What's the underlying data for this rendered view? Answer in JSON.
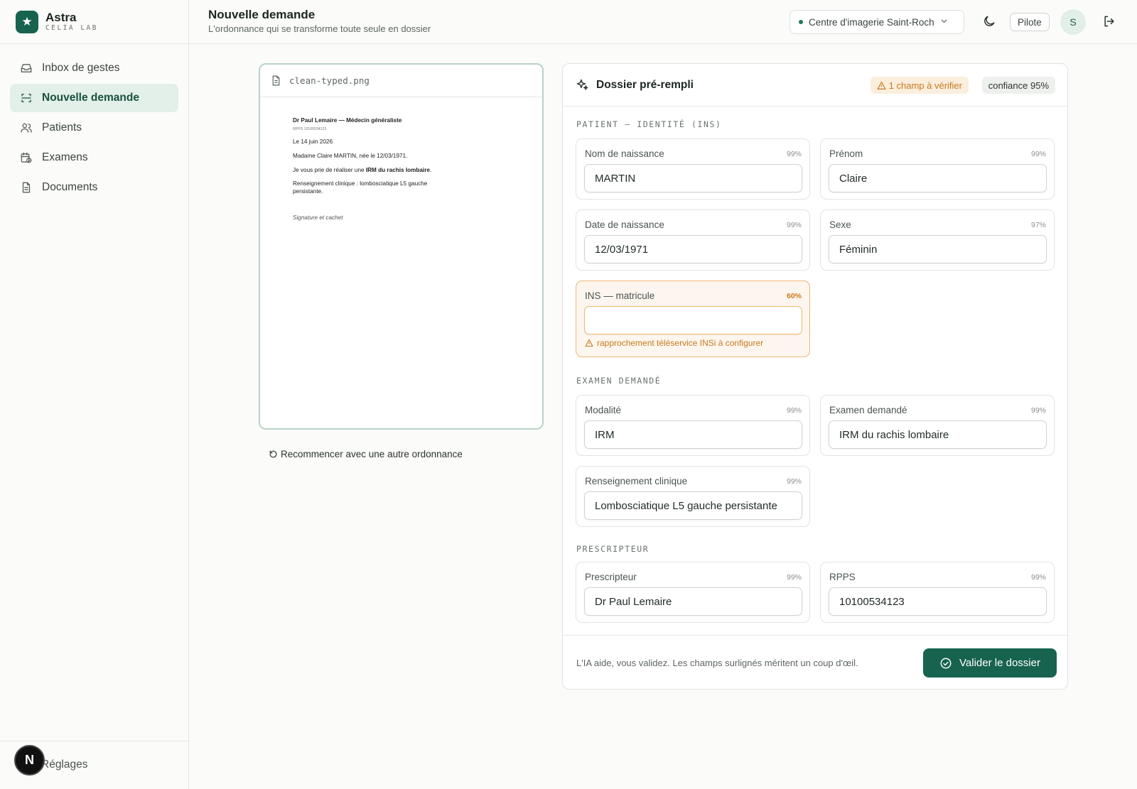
{
  "brand": {
    "name": "Astra",
    "sub": "CELIA LAB",
    "logo_icon": "star-icon"
  },
  "sidebar": {
    "items": [
      {
        "label": "Inbox de gestes",
        "icon": "inbox-icon",
        "active": false
      },
      {
        "label": "Nouvelle demande",
        "icon": "scan-icon",
        "active": true
      },
      {
        "label": "Patients",
        "icon": "users-icon",
        "active": false
      },
      {
        "label": "Examens",
        "icon": "calendar-clock-icon",
        "active": false
      },
      {
        "label": "Documents",
        "icon": "document-icon",
        "active": false
      }
    ],
    "settings_label": "Réglages",
    "n_badge": "N"
  },
  "header": {
    "title": "Nouvelle demande",
    "subtitle": "L'ordonnance qui se transforme toute seule en dossier",
    "center": "Centre d'imagerie Saint-Roch",
    "mode_badge": "Pilote",
    "avatar": "S"
  },
  "document": {
    "filename": "clean-typed.png",
    "lines": {
      "doctor": "Dr Paul Lemaire — Médecin généraliste",
      "rpps": "RPPS 10100534123",
      "date": "Le 14 juin 2026",
      "patient": "Madame Claire MARTIN, née le 12/03/1971.",
      "request_prefix": "Je vous prie de réaliser une ",
      "request_exam": "IRM du rachis lombaire",
      "request_suffix": ".",
      "clinical_1": "Renseignement clinique : lombosciatique L5 gauche",
      "clinical_2": "persistante.",
      "signature": "Signature et cachet"
    },
    "restart_label": "Recommencer avec une autre ordonnance"
  },
  "dossier": {
    "title": "Dossier pré-rempli",
    "warning_badge": "1 champ à vérifier",
    "confidence_badge": "confiance 95%",
    "sections": {
      "patient": "PATIENT — IDENTITÉ (INS)",
      "exam": "EXAMEN DEMANDÉ",
      "prescriber": "PRESCRIPTEUR"
    },
    "fields": {
      "nom": {
        "label": "Nom de naissance",
        "confidence": "99%",
        "value": "MARTIN"
      },
      "prenom": {
        "label": "Prénom",
        "confidence": "99%",
        "value": "Claire"
      },
      "dob": {
        "label": "Date de naissance",
        "confidence": "99%",
        "value": "12/03/1971"
      },
      "sexe": {
        "label": "Sexe",
        "confidence": "97%",
        "value": "Féminin"
      },
      "ins": {
        "label": "INS — matricule",
        "confidence": "60%",
        "value": "",
        "hint": "rapprochement téléservice INSi à configurer"
      },
      "modalite": {
        "label": "Modalité",
        "confidence": "99%",
        "value": "IRM"
      },
      "examen": {
        "label": "Examen demandé",
        "confidence": "99%",
        "value": "IRM du rachis lombaire"
      },
      "clinique": {
        "label": "Renseignement clinique",
        "confidence": "99%",
        "value": "Lombosciatique L5 gauche persistante"
      },
      "prescripteur": {
        "label": "Prescripteur",
        "confidence": "99%",
        "value": "Dr Paul Lemaire"
      },
      "rpps": {
        "label": "RPPS",
        "confidence": "99%",
        "value": "10100534123"
      }
    },
    "footer_text": "L'IA aide, vous validez. Les champs surlignés méritent un coup d'œil.",
    "validate_label": "Valider le dossier"
  },
  "colors": {
    "accent": "#17634f",
    "active_bg": "#e3efe9",
    "warning": "#c9791f",
    "warning_bg": "#fdf6ee"
  }
}
